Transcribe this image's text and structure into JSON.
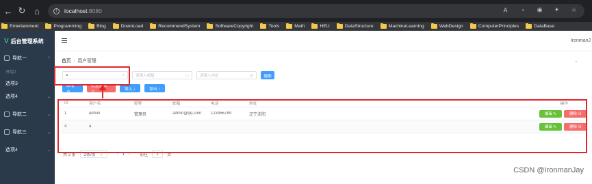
{
  "browser": {
    "url_host": "localhost",
    "url_port": ":8080",
    "bookmarks": [
      "Entertainment",
      "Programming",
      "Blog",
      "DownLoad",
      "RecommendSystem",
      "SoftwareCopyright",
      "Tools",
      "Math",
      "HEU",
      "DataStructure",
      "MachineLearning",
      "WebDesign",
      "ComputerPrinciples",
      "DataBase"
    ]
  },
  "sidebar": {
    "logo": "后台管理系统",
    "items": [
      {
        "label": "导航一"
      },
      {
        "label": "分组2"
      },
      {
        "label": "选项3"
      },
      {
        "label": "选项4"
      },
      {
        "label": "导航二"
      },
      {
        "label": "导航三"
      },
      {
        "label": "选项4"
      }
    ]
  },
  "header": {
    "user": "IronmanJ"
  },
  "breadcrumb": {
    "home": "首页",
    "sep": "/",
    "current": "用户管理"
  },
  "search": {
    "name_value": "a",
    "email_placeholder": "请输入邮箱",
    "address_placeholder": "请输入地址",
    "search_label": "搜索"
  },
  "actions": {
    "add": "新增 ⊕",
    "batch_delete": "批量删除 ⊖",
    "import": "导入 ↓",
    "export": "导出 ↑"
  },
  "table": {
    "columns": [
      "ID",
      "用户名",
      "昵称",
      "邮箱",
      "电话",
      "地址",
      "操作"
    ],
    "rows": [
      {
        "id": "1",
        "username": "admin",
        "nickname": "管理员",
        "email": "admin@qq.com",
        "phone": "123456789",
        "address": "辽宁沈阳"
      },
      {
        "id": "4",
        "username": "a",
        "nickname": "",
        "email": "",
        "phone": "",
        "address": ""
      }
    ],
    "edit_label": "编辑 ✎",
    "delete_label": "删除 ⊖"
  },
  "pager": {
    "total": "共 2 条",
    "size": "2条/页",
    "current": "1",
    "goto_prefix": "前往",
    "goto_value": "1",
    "goto_suffix": "页"
  },
  "watermark": "CSDN @IronmanJay",
  "colors": {
    "accent": "#409eff",
    "danger": "#f56c6c",
    "success": "#67c23a",
    "highlight": "#e0262b",
    "sidebar": "#2b3a4a"
  }
}
